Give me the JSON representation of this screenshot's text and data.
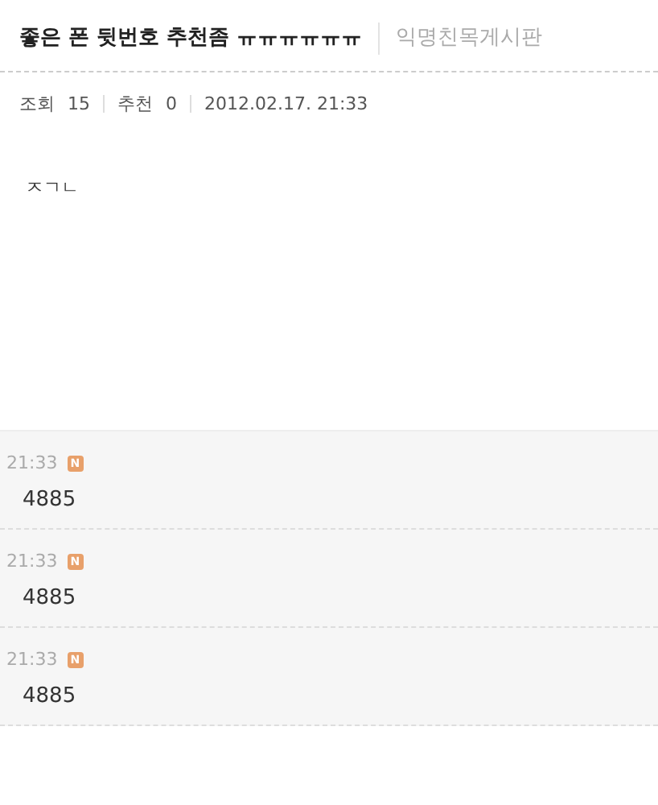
{
  "post": {
    "title": "좋은 폰 뒷번호 추천좀 ㅠㅠㅠㅠㅠㅠ",
    "board": "익명친목게시판",
    "views_label": "조회",
    "views": "15",
    "recommend_label": "추천",
    "recommends": "0",
    "date": "2012.02.17. 21:33",
    "body": "ㅈㄱㄴ"
  },
  "comments": [
    {
      "time": "21:33",
      "badge": "N",
      "text": "4885"
    },
    {
      "time": "21:33",
      "badge": "N",
      "text": "4885"
    },
    {
      "time": "21:33",
      "badge": "N",
      "text": "4885"
    }
  ]
}
